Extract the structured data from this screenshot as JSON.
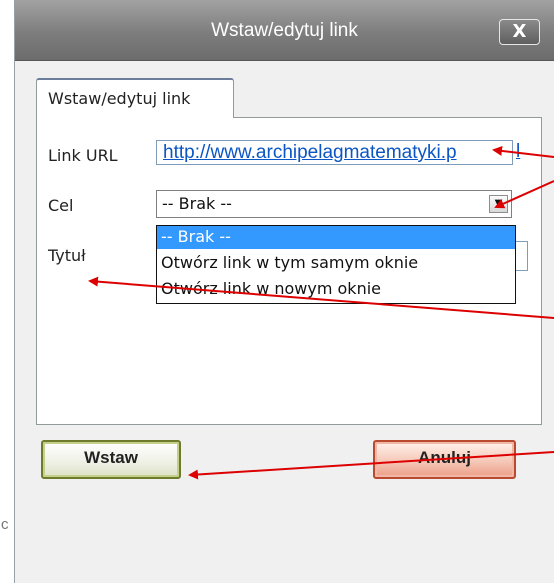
{
  "dialog": {
    "title": "Wstaw/edytuj link",
    "close_label": "X"
  },
  "tabs": [
    {
      "label": "Wstaw/edytuj link",
      "active": true
    }
  ],
  "form": {
    "url_label": "Link URL",
    "url_value": "http://www.archipelagmatematyki.p",
    "url_overflow": "l",
    "target_label": "Cel",
    "target_value": "-- Brak --",
    "title_label": "Tytuł",
    "target_options": [
      {
        "label": "-- Brak --",
        "selected": true
      },
      {
        "label": "Otwórz link w tym samym oknie",
        "selected": false
      },
      {
        "label": "Otwórz link w nowym oknie",
        "selected": false
      }
    ]
  },
  "buttons": {
    "insert_label": "Wstaw",
    "cancel_label": "Anuluj"
  },
  "backdrop": {
    "partial_char": "c"
  },
  "colors": {
    "titlebar": "#7d7d7d",
    "link": "#0b55c4",
    "selection": "#3399ff",
    "annotation_arrow": "#dd0000",
    "insert_border": "#6e7a2c",
    "cancel_border": "#b94a2f"
  },
  "icons": {
    "close": "close-icon",
    "dropdown": "chevron-down-icon"
  }
}
